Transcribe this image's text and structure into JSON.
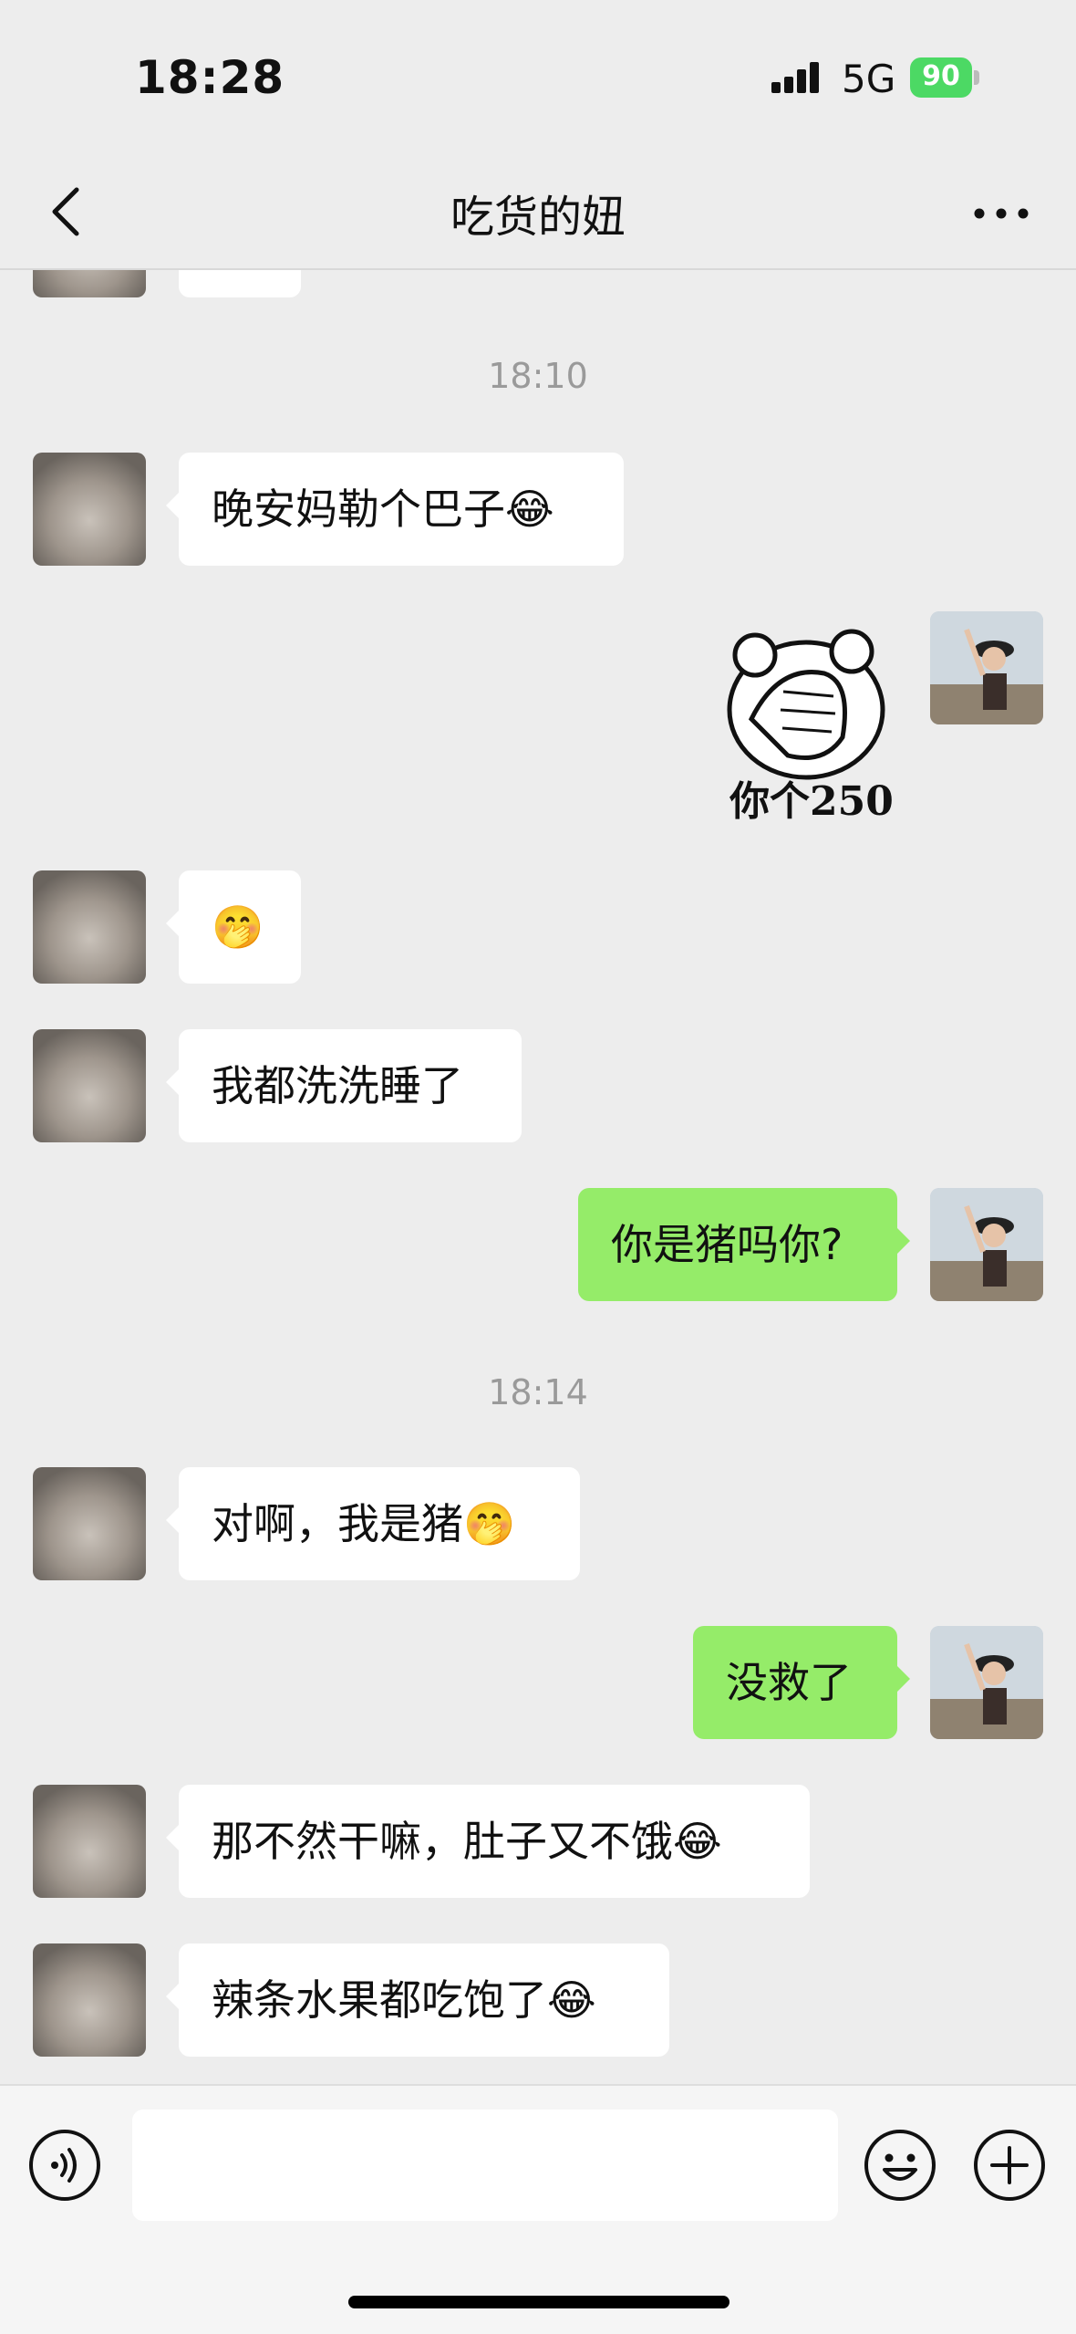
{
  "status_bar": {
    "time": "18:28",
    "network": "5G",
    "battery": "90",
    "battery_color": "#4cd964"
  },
  "nav": {
    "title": "吃货的妞",
    "back_icon": "chevron-left-icon",
    "more_icon": "more-dots-icon"
  },
  "messages": [
    {
      "type": "timestamp",
      "text": "18:10"
    },
    {
      "type": "text",
      "side": "in",
      "text": "晚安妈勒个巴子",
      "emoji": "😂"
    },
    {
      "type": "sticker",
      "side": "out",
      "caption": "你个250"
    },
    {
      "type": "text",
      "side": "in",
      "text": "",
      "emoji": "🤭"
    },
    {
      "type": "text",
      "side": "in",
      "text": "我都洗洗睡了",
      "emoji": ""
    },
    {
      "type": "text",
      "side": "out",
      "text": "你是猪吗你?",
      "emoji": ""
    },
    {
      "type": "timestamp",
      "text": "18:14"
    },
    {
      "type": "text",
      "side": "in",
      "text": "对啊，我是猪",
      "emoji": "🤭"
    },
    {
      "type": "text",
      "side": "out",
      "text": "没救了",
      "emoji": ""
    },
    {
      "type": "text",
      "side": "in",
      "text": "那不然干嘛，肚子又不饿",
      "emoji": "😂"
    },
    {
      "type": "text",
      "side": "in",
      "text": "辣条水果都吃饱了",
      "emoji": "😂"
    }
  ],
  "input_bar": {
    "voice_icon": "voice-icon",
    "emoji_icon": "emoji-icon",
    "add_icon": "plus-circle-icon",
    "placeholder": ""
  },
  "colors": {
    "background": "#ededed",
    "incoming_bubble": "#ffffff",
    "outgoing_bubble": "#95ec69"
  }
}
